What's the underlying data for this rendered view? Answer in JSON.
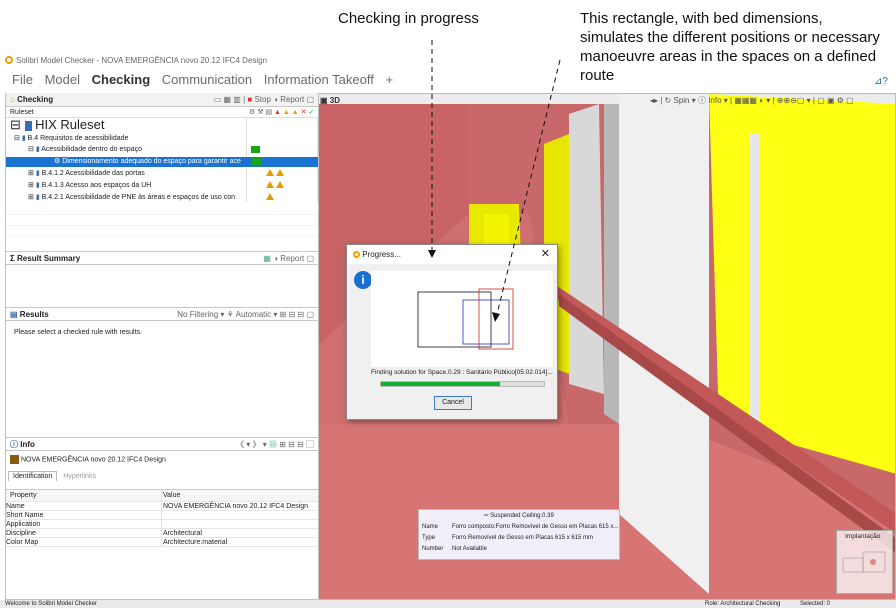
{
  "annotations": {
    "progress_note": "Checking in progress",
    "rect_note": "This rectangle, with bed dimensions, simulates the different positions or necessary manoeuvre areas in the spaces on a defined route"
  },
  "app": {
    "title": "Solibri Model Checker - NOVA EMERGÊNCIA novo 20.12 IFC4 Design"
  },
  "menu": [
    "File",
    "Model",
    "Checking",
    "Communication",
    "Information Takeoff",
    "+"
  ],
  "checking": {
    "title": "Checking",
    "ruleset_label": "Ruleset",
    "stop": "Stop",
    "report": "Report",
    "rows": [
      "HIX Ruleset",
      "B.4 Requisitos de acessibilidade",
      "Acessibilidade dentro do espaço",
      "Dimensionamento adequado do espaço para garantir ace",
      "B.4.1.2 Acessibilidade das portas",
      "B.4.1.3 Acesso aos espaços da UH",
      "B.4.2.1 Acessibilidade de PNE às áreas e espaços de uso con"
    ]
  },
  "result_summary": {
    "title": "Result Summary",
    "report": "Report"
  },
  "results": {
    "title": "Results",
    "filter": "No Filtering",
    "auto": "Automatic",
    "message": "Please select a checked rule with results."
  },
  "info": {
    "title": "Info",
    "model_name": "NOVA EMERGÊNCIA novo 20.12 IFC4 Design",
    "tabs": [
      "Identification",
      "Hyperlinks"
    ],
    "headers": [
      "Property",
      "Value"
    ],
    "rows": [
      [
        "Name",
        "NOVA EMERGÊNCIA novo 20.12 IFC4 Design"
      ],
      [
        "Short Name",
        ""
      ],
      [
        "Application",
        ""
      ],
      [
        "Discipline",
        "Architectural"
      ],
      [
        "Color Map",
        "Architecture.material"
      ]
    ]
  },
  "view": {
    "label": "3D",
    "spin": "Spin",
    "info": "Info"
  },
  "dialog": {
    "title": "Progress...",
    "status": "Finding solution for Space.0.29 : Sanitário Público[05.02.014]...",
    "progress": 0.73,
    "cancel": "Cancel"
  },
  "tooltip": {
    "title": "Suspended Ceiling.0.39",
    "rows": [
      [
        "Name",
        "Forro composto:Forro Removível de Gesso em Placas 615 x..."
      ],
      [
        "Type",
        "Forro Removível de Gesso em Placas 615 x 615 mm"
      ],
      [
        "Number",
        "Not Available"
      ]
    ]
  },
  "minimap": {
    "label": "Implantação"
  },
  "statusbar": {
    "welcome": "Welcome to Solibri Model Checker",
    "role": "Role: Architectural Checking",
    "selected": "Selected: 0"
  }
}
